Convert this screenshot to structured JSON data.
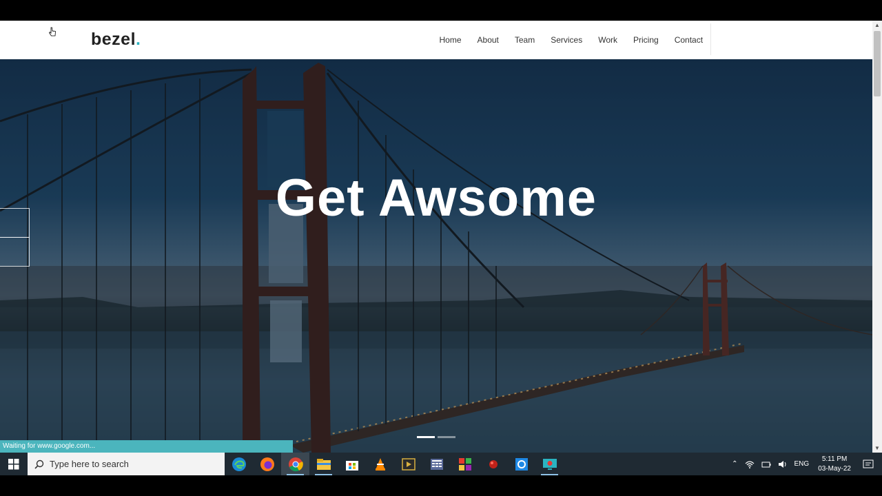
{
  "site": {
    "logo_text": "bezel",
    "logo_dot": ".",
    "logo_dot_color": "#2bb3c0",
    "nav": [
      "Home",
      "About",
      "Team",
      "Services",
      "Work",
      "Pricing",
      "Contact"
    ]
  },
  "hero": {
    "title": "Get Awsome",
    "slides": {
      "count": 2,
      "active": 0
    }
  },
  "browser": {
    "status_text": "Waiting for www.google.com..."
  },
  "taskbar": {
    "search_placeholder": "Type here to search",
    "apps": [
      "edge-icon",
      "firefox-icon",
      "chrome-icon",
      "file-explorer-icon",
      "store-icon",
      "vlc-icon",
      "media-player-icon",
      "calculator-icon",
      "office-icon",
      "ruby-icon",
      "sync-icon",
      "screen-recorder-icon"
    ],
    "language": "ENG",
    "time": "5:11 PM",
    "date": "03-May-22"
  }
}
